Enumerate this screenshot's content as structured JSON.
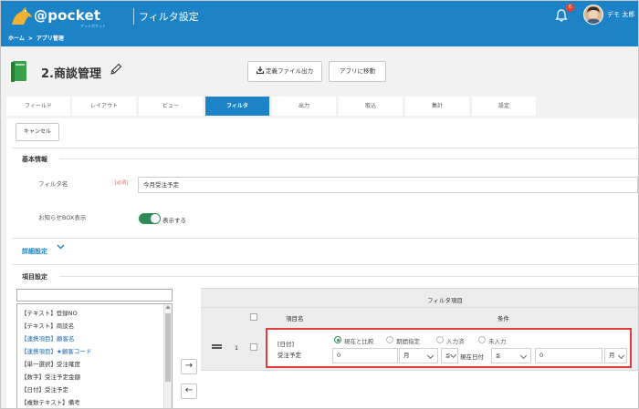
{
  "header": {
    "logo_text": "@pocket",
    "logo_tagline": "アットポケット",
    "app_title": "フィルタ設定",
    "notification_count": "6",
    "user_name": "デモ 太郎",
    "breadcrumb": [
      "ホーム",
      ">",
      "アプリ管理"
    ]
  },
  "page": {
    "title": "2.商談管理",
    "export_button": "定義ファイル出力",
    "move_button": "アプリに移動"
  },
  "tabs": [
    "フィールド",
    "レイアウト",
    "ビュー",
    "フィルタ",
    "出力",
    "取込",
    "集計",
    "設定"
  ],
  "active_tab": "フィルタ",
  "cancel_button": "キャンセル",
  "basic": {
    "section_title": "基本情報",
    "filter_name_label": "フィルタ名",
    "required_label": "[必須]",
    "filter_name_value": "今月受注予定",
    "notice_label": "お知らせBOX表示",
    "toggle_text": "表示する"
  },
  "advanced_title": "詳細設定",
  "items_title": "項目設定",
  "available_items": [
    {
      "label": "【テキスト】登録NO",
      "linked": false
    },
    {
      "label": "【テキスト】商談名",
      "linked": false
    },
    {
      "label": "【連携項目】顧客名",
      "linked": true
    },
    {
      "label": "【連携項目】★顧客コード",
      "linked": true
    },
    {
      "label": "【単一選択】受注確度",
      "linked": false
    },
    {
      "label": "【数字】受注予定金額",
      "linked": false
    },
    {
      "label": "【日付】受注予定",
      "linked": false
    },
    {
      "label": "【複数テキスト】備考",
      "linked": false
    }
  ],
  "filter_table": {
    "title": "フィルタ項目",
    "col_item": "項目名",
    "col_condition": "条件"
  },
  "filter_row": {
    "index": "1",
    "type_label": "[日付]",
    "field_name": "受注予定",
    "radio_options": [
      "現在と比較",
      "期間指定",
      "入力済",
      "未入力"
    ],
    "selected_option": "現在と比較",
    "value1": "0",
    "unit1": "月",
    "op1": "≦",
    "current_date_label": "現在日付",
    "op2": "≦",
    "value2": "0",
    "unit2": "月"
  },
  "colors": {
    "brand": "#1c84c6",
    "highlight": "#e33a3a",
    "toggle_on": "#2e8b57"
  }
}
